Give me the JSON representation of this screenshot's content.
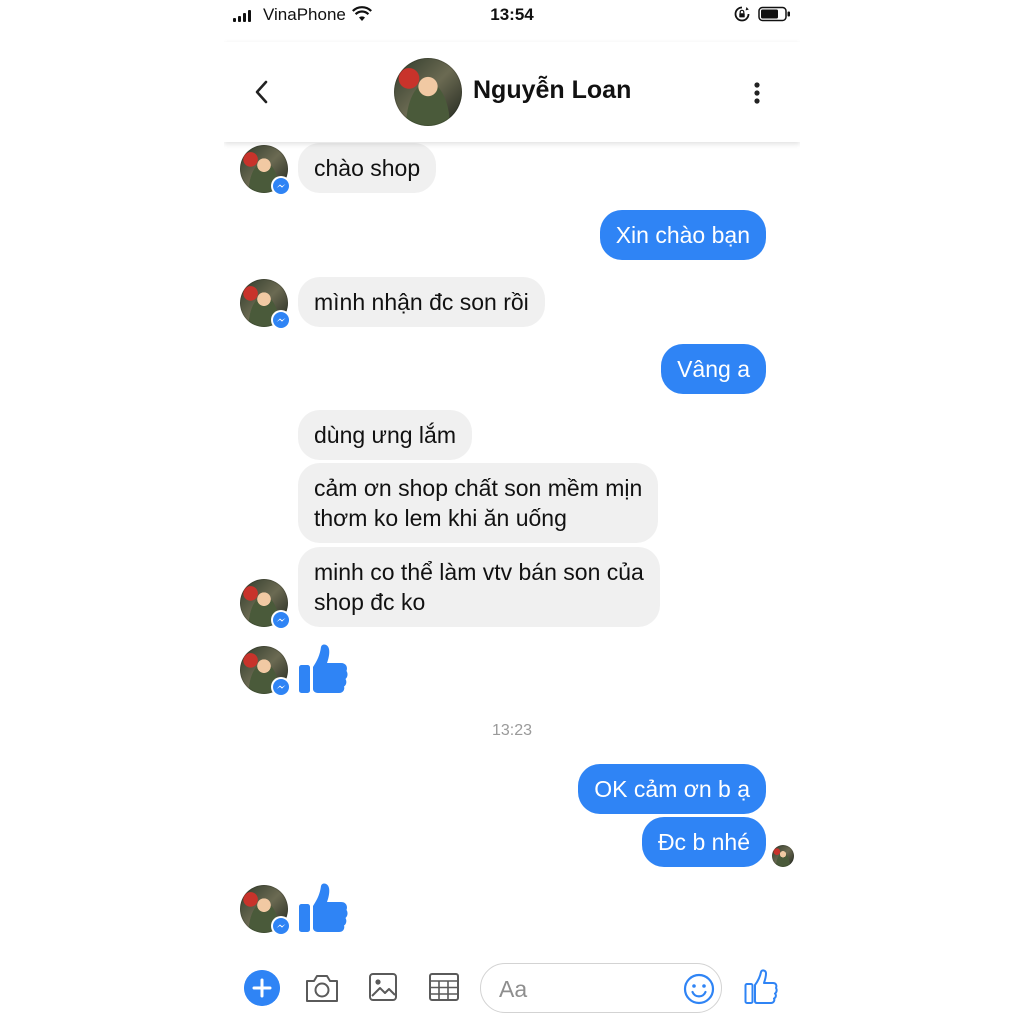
{
  "status_bar": {
    "carrier": "VinaPhone",
    "time": "13:54"
  },
  "header": {
    "contact_name": "Nguyễn Loan"
  },
  "messages": [
    {
      "from": "contact",
      "text": "chào shop"
    },
    {
      "from": "me",
      "text": "Xin chào bạn"
    },
    {
      "from": "contact",
      "text": "mình nhận đc son rồi"
    },
    {
      "from": "me",
      "text": "Vâng a"
    },
    {
      "from": "contact",
      "text": "dùng ưng lắm"
    },
    {
      "from": "contact",
      "lines": [
        "cảm ơn shop chất son mềm mịn",
        "thơm ko lem khi ăn uống"
      ]
    },
    {
      "from": "contact",
      "lines": [
        "minh co thể làm vtv bán son của",
        "shop đc ko"
      ]
    },
    {
      "from": "contact",
      "sticker": "like-icon"
    },
    {
      "divider": "13:23"
    },
    {
      "from": "me",
      "text": "OK cảm ơn b ạ"
    },
    {
      "from": "me",
      "text": "Đc b nhé"
    },
    {
      "from": "contact",
      "sticker": "like-icon"
    }
  ],
  "composer": {
    "placeholder": "Aa",
    "icons": [
      "plus-icon",
      "camera-icon",
      "image-icon",
      "grid-icon",
      "emoji-icon",
      "like-icon"
    ]
  },
  "colors": {
    "accent": "#2f84f5",
    "incoming_bubble": "#f0f0f0",
    "timestamp": "#9a9a9a"
  }
}
